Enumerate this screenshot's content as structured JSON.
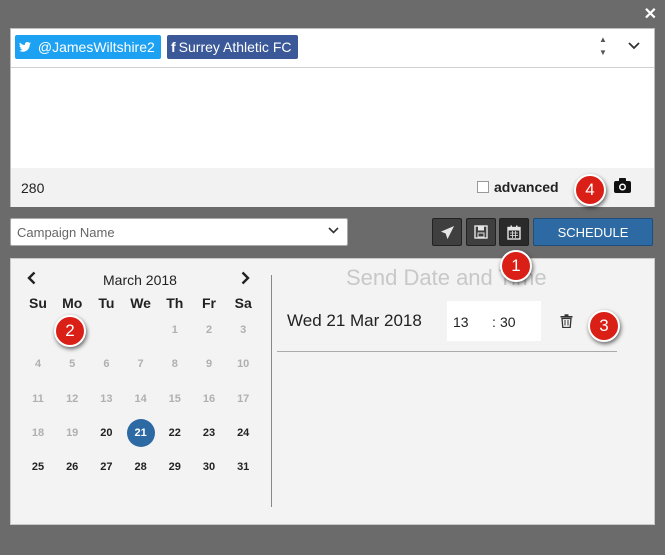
{
  "window": {
    "close_label": "✕"
  },
  "composer": {
    "accounts": [
      {
        "network": "twitter",
        "label": "@JamesWiltshire2",
        "icon": "twitter-bird-icon"
      },
      {
        "network": "facebook",
        "label": "Surrey Athletic FC",
        "icon": "facebook-f-icon"
      }
    ],
    "message_text": "",
    "char_count": "280",
    "advanced_label": "advanced",
    "advanced_checked": false
  },
  "toolbar": {
    "campaign_placeholder": "Campaign Name",
    "schedule_label": "SCHEDULE"
  },
  "calendar": {
    "month_label": "March 2018",
    "weekdays": [
      "Su",
      "Mo",
      "Tu",
      "We",
      "Th",
      "Fr",
      "Sa"
    ],
    "selected_day": "21",
    "weeks": [
      [
        "",
        "",
        "",
        "",
        "1",
        "2",
        "3"
      ],
      [
        "4",
        "5",
        "6",
        "7",
        "8",
        "9",
        "10"
      ],
      [
        "11",
        "12",
        "13",
        "14",
        "15",
        "16",
        "17"
      ],
      [
        "18",
        "19",
        "20",
        "21",
        "22",
        "23",
        "24"
      ],
      [
        "25",
        "26",
        "27",
        "28",
        "29",
        "30",
        "31"
      ]
    ],
    "first_enabled_day": 20
  },
  "send": {
    "heading": "Send Date and Time",
    "date_text": "Wed 21 Mar 2018",
    "hour": "13",
    "minute": "30"
  },
  "markers": [
    "1",
    "2",
    "3",
    "4"
  ],
  "colors": {
    "twitter": "#1da1f2",
    "facebook": "#3b5998",
    "schedule_button": "#2d6aa3",
    "selected_day": "#2d6aa3",
    "marker": "#d91f16"
  }
}
